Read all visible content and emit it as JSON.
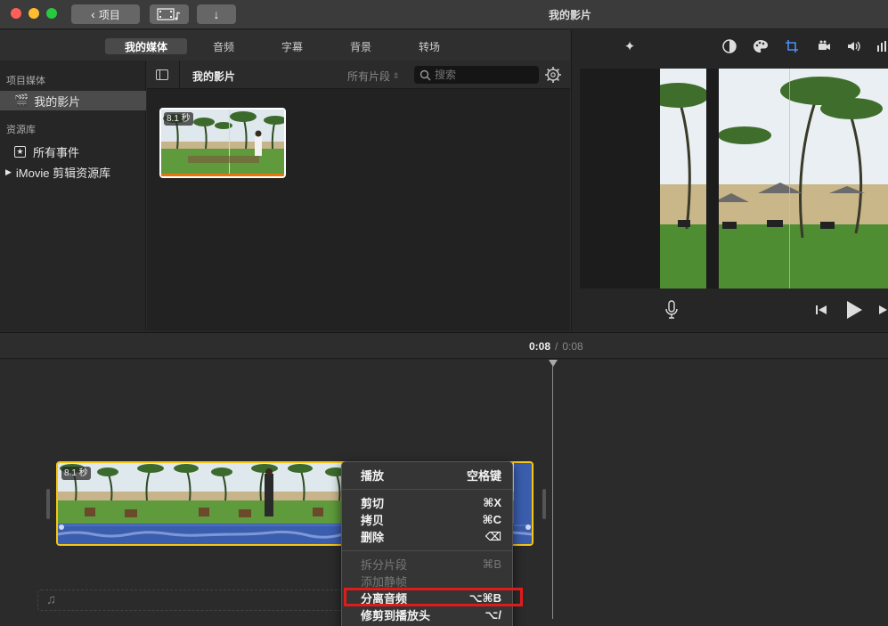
{
  "window": {
    "title": "我的影片",
    "back_label": "项目"
  },
  "tabs": [
    {
      "label": "我的媒体",
      "active": true
    },
    {
      "label": "音频",
      "active": false
    },
    {
      "label": "字幕",
      "active": false
    },
    {
      "label": "背景",
      "active": false
    },
    {
      "label": "转场",
      "active": false
    }
  ],
  "sidebar": {
    "section1": "项目媒体",
    "project_item": "我的影片",
    "section2": "资源库",
    "all_events": "所有事件",
    "library": "iMovie 剪辑资源库"
  },
  "browser": {
    "title": "我的影片",
    "filter_label": "所有片段",
    "search_placeholder": "搜索",
    "clip_duration": "8.1 秒"
  },
  "timeline": {
    "current_time": "0:08",
    "separator": "/",
    "total_time": "0:08",
    "clip_duration": "8.1 秒"
  },
  "context_menu": {
    "items": [
      {
        "label": "播放",
        "shortcut": "空格键",
        "enabled": true
      },
      {
        "label": "剪切",
        "shortcut": "⌘X",
        "enabled": true
      },
      {
        "label": "拷贝",
        "shortcut": "⌘C",
        "enabled": true
      },
      {
        "label": "删除",
        "shortcut": "⌫",
        "enabled": true
      },
      {
        "label": "拆分片段",
        "shortcut": "⌘B",
        "enabled": false
      },
      {
        "label": "添加静帧",
        "shortcut": "",
        "enabled": false
      },
      {
        "label": "分离音频",
        "shortcut": "⌥⌘B",
        "enabled": true,
        "highlighted": true
      },
      {
        "label": "修剪到播放头",
        "shortcut": "⌥/",
        "enabled": true
      }
    ]
  },
  "colors": {
    "accent_selection": "#f5c518",
    "highlight_box": "#e01b1b",
    "audio_wave": "#3a5dad"
  }
}
